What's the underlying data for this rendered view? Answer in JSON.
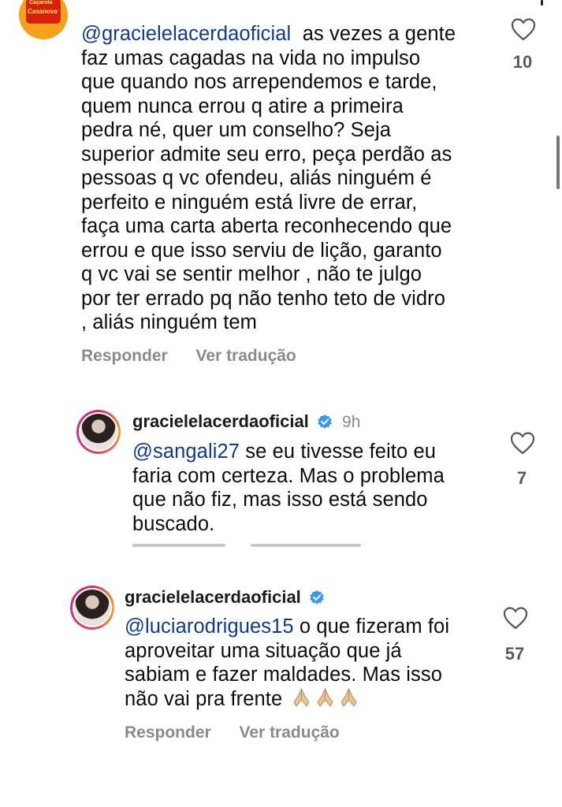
{
  "comment1": {
    "avatar_text": [
      "Caçarola",
      "Casanova"
    ],
    "mention": "@gracielelacerdaoficial",
    "lines": [
      "as vezes a gente",
      "faz umas cagadas na vida no impulso",
      "que quando nos arrependemos e tarde,",
      "quem nunca errou q atire a primeira",
      "pedra né, quer um conselho? Seja",
      "superior admite seu erro, peça perdão as",
      "pessoas q vc ofendeu, aliás ninguém é",
      "perfeito e ninguém está livre de errar,",
      "faça uma carta aberta reconhecendo que",
      "errou e que isso serviu de lição, garanto",
      "q vc vai se sentir melhor , não te julgo",
      "por ter errado pq não tenho teto de vidro",
      ", aliás ninguém tem"
    ],
    "likes": "10",
    "reply_label": "Responder",
    "translate_label": "Ver tradução"
  },
  "reply1": {
    "username": "gracielelacerdaoficial",
    "time": "9h",
    "mention": "@sangali27",
    "lines": [
      "se eu tivesse feito eu",
      "faria com certeza. Mas o problema",
      "que não fiz, mas isso está sendo",
      "buscado."
    ],
    "likes": "7"
  },
  "reply2": {
    "username": "gracielelacerdaoficial",
    "mention": "@luciarodrigues15",
    "lines": [
      "o que fizeram foi",
      "aproveitar uma situação que já",
      "sabiam e fazer maldades. Mas isso",
      "não vai pra frente"
    ],
    "emoji": "folded-hands-icon x3",
    "likes": "57",
    "reply_label": "Responder",
    "translate_label": "Ver tradução"
  },
  "colors": {
    "mention": "#0f3b8a",
    "muted": "#8a8a8a",
    "verified": "#3897f0"
  }
}
